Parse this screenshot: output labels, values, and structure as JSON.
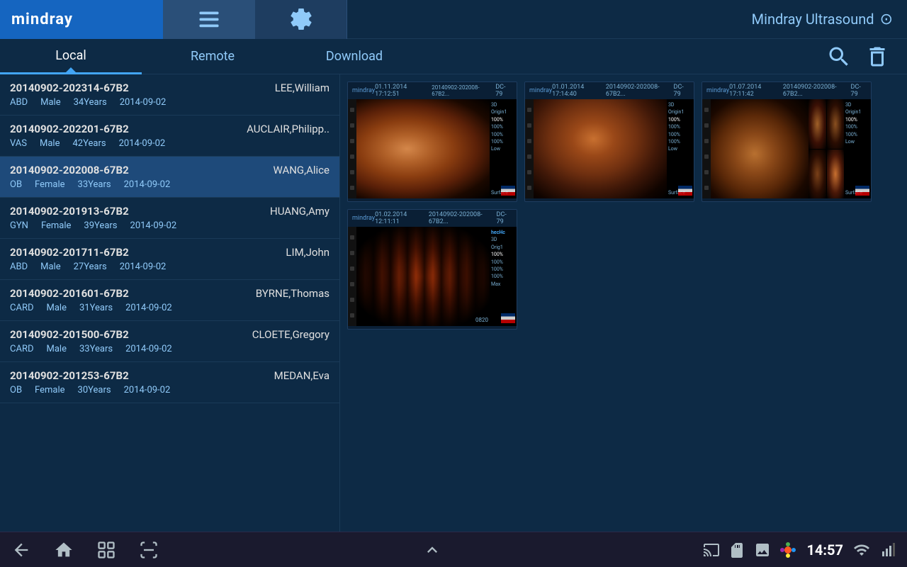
{
  "app": {
    "title": "Mindray Ultrasound",
    "logo": "mindray"
  },
  "topBar": {
    "list_icon": "list-icon",
    "settings_icon": "settings-icon",
    "wifi_symbol": "⊙"
  },
  "tabs": {
    "items": [
      {
        "id": "local",
        "label": "Local",
        "active": true
      },
      {
        "id": "remote",
        "label": "Remote",
        "active": false
      },
      {
        "id": "download",
        "label": "Download",
        "active": false
      }
    ],
    "search_label": "search",
    "delete_label": "delete"
  },
  "patients": [
    {
      "id": "20140902-202314-67B2",
      "name": "LEE,William",
      "type": "ABD",
      "gender": "Male",
      "age": "34Years",
      "date": "2014-09-02",
      "selected": false
    },
    {
      "id": "20140902-202201-67B2",
      "name": "AUCLAIR,Philipp..",
      "type": "VAS",
      "gender": "Male",
      "age": "42Years",
      "date": "2014-09-02",
      "selected": false
    },
    {
      "id": "20140902-202008-67B2",
      "name": "WANG,Alice",
      "type": "OB",
      "gender": "Female",
      "age": "33Years",
      "date": "2014-09-02",
      "selected": true
    },
    {
      "id": "20140902-201913-67B2",
      "name": "HUANG,Amy",
      "type": "GYN",
      "gender": "Female",
      "age": "39Years",
      "date": "2014-09-02",
      "selected": false
    },
    {
      "id": "20140902-201711-67B2",
      "name": "LIM,John",
      "type": "ABD",
      "gender": "Male",
      "age": "27Years",
      "date": "2014-09-02",
      "selected": false
    },
    {
      "id": "20140902-201601-67B2",
      "name": "BYRNE,Thomas",
      "type": "CARD",
      "gender": "Male",
      "age": "31Years",
      "date": "2014-09-02",
      "selected": false
    },
    {
      "id": "20140902-201500-67B2",
      "name": "CLOETE,Gregory",
      "type": "CARD",
      "gender": "Male",
      "age": "33Years",
      "date": "2014-09-02",
      "selected": false
    },
    {
      "id": "20140902-201253-67B2",
      "name": "MEDAN,Eva",
      "type": "OB",
      "gender": "Female",
      "age": "30Years",
      "date": "2014-09-02",
      "selected": false
    }
  ],
  "thumbnails": [
    {
      "id": "thumb-1",
      "type": "face"
    },
    {
      "id": "thumb-2",
      "type": "face2"
    },
    {
      "id": "thumb-3",
      "type": "mixed"
    },
    {
      "id": "thumb-4",
      "type": "spine"
    }
  ],
  "bottomBar": {
    "back": "back",
    "home": "home",
    "recents": "recents",
    "scan": "scan",
    "up": "up",
    "time": "14:57",
    "icons": [
      "screen-cast",
      "sd-card",
      "image",
      "color-app"
    ]
  }
}
